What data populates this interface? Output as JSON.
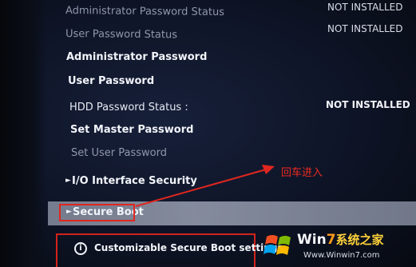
{
  "menu": {
    "admin_password_status": {
      "label": "Administrator Password Status",
      "value": "NOT INSTALLED"
    },
    "user_password_status": {
      "label": "User Password Status",
      "value": "NOT INSTALLED"
    },
    "admin_password": {
      "label": "Administrator Password"
    },
    "user_password": {
      "label": "User Password"
    },
    "hdd_password_status": {
      "label": "HDD Password Status  :",
      "value": "NOT INSTALLED"
    },
    "set_master_password": {
      "label": "Set Master Password"
    },
    "set_user_password": {
      "label": "Set User Password"
    },
    "io_interface_security": {
      "label": "I/O Interface Security"
    },
    "secure_boot": {
      "label": "Secure Boot"
    }
  },
  "footer": {
    "info_text": "Customizable Secure Boot settings"
  },
  "annotation": {
    "text": "回车进入",
    "color": "#ef2a22"
  },
  "watermark": {
    "brand_win": "Win",
    "brand_seven": "7",
    "brand_cn": "系统之家",
    "url": "Www.Winwin7.com"
  },
  "colors": {
    "highlight": "#8e95a6",
    "annotation_red": "#e0261f",
    "text_white": "#f2f4fa",
    "text_dim": "#8f97ab"
  },
  "icons": {
    "info": "info-icon",
    "pointer": "pointer-triangle-icon",
    "logo": "windows-logo-icon"
  }
}
